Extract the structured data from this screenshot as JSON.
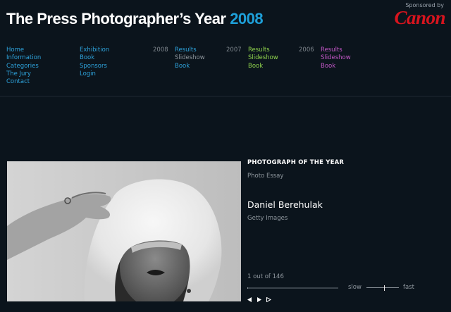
{
  "header": {
    "title_main": "The Press Photographer’s Year",
    "title_year": "2008",
    "sponsor_label": "Sponsored by",
    "sponsor_logo": "Canon"
  },
  "nav": {
    "main": [
      "Home",
      "Information",
      "Categories",
      "The Jury",
      "Contact"
    ],
    "secondary": [
      "Exhibition",
      "Book",
      "Sponsors",
      "Login"
    ],
    "years": [
      {
        "year": "2008",
        "links": [
          "Results",
          "Slideshow",
          "Book"
        ],
        "color": "#2ea3dc",
        "slideshow_color": "#8f979e"
      },
      {
        "year": "2007",
        "links": [
          "Results",
          "Slideshow",
          "Book"
        ],
        "color": "#8ed14c"
      },
      {
        "year": "2006",
        "links": [
          "Results",
          "Slideshow",
          "Book"
        ],
        "color": "#c457c8"
      }
    ]
  },
  "photo": {
    "category": "PHOTOGRAPH OF THE YEAR",
    "section": "Photo Essay",
    "photographer": "Daniel Berehulak",
    "agency": "Getty Images"
  },
  "slideshow": {
    "counter": "1 out of 146",
    "current": 1,
    "total": 146,
    "speed_slow_label": "slow",
    "speed_fast_label": "fast",
    "speed_level": 0.55,
    "controls": [
      "prev-icon",
      "play-icon",
      "next-icon"
    ]
  }
}
